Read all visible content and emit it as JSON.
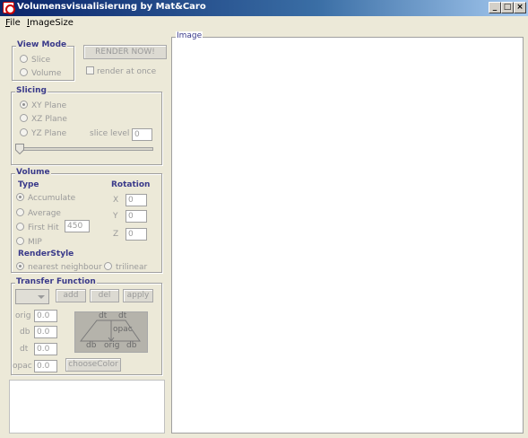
{
  "window": {
    "title": "Volumensvisualisierung by Mat&Caro",
    "min": "_",
    "max": "□",
    "close": "×"
  },
  "menu": [
    {
      "accel": "F",
      "rest": "ile"
    },
    {
      "accel": "I",
      "rest": "mageSize"
    }
  ],
  "view_mode": {
    "legend": "View Mode",
    "slice": "Slice",
    "volume": "Volume",
    "render_button": "RENDER NOW!",
    "render_at_once": "render at once"
  },
  "slicing": {
    "legend": "Slicing",
    "xy": "XY Plane",
    "xz": "XZ Plane",
    "yz": "YZ Plane",
    "slice_level_label": "slice level",
    "slice_level_value": "0",
    "slider_value": 0
  },
  "volume": {
    "legend": "Volume",
    "type_label": "Type",
    "rotation_label": "Rotation",
    "accumulate": "Accumulate",
    "average": "Average",
    "first_hit": "First Hit",
    "first_hit_value": "450",
    "mip": "MIP",
    "rot_x_label": "X",
    "rot_x": "0",
    "rot_y_label": "Y",
    "rot_y": "0",
    "rot_z_label": "Z",
    "rot_z": "0",
    "render_style_label": "RenderStyle",
    "nearest": "nearest neighbour",
    "trilinear": "trilinear"
  },
  "transfer": {
    "legend": "Transfer Function",
    "add": "add",
    "del": "del",
    "apply": "apply",
    "orig_label": "orig",
    "orig": "0.0",
    "db_label": "db",
    "db": "0.0",
    "dt_label": "dt",
    "dt": "0.0",
    "opac_label": "opac",
    "opac": "0.0",
    "choose_color": "chooseColor",
    "graph": {
      "dt1": "dt",
      "dt2": "dt",
      "opac": "opac",
      "db1": "db",
      "orig": "orig",
      "db2": "db"
    }
  },
  "image_panel": {
    "legend": "Image"
  }
}
